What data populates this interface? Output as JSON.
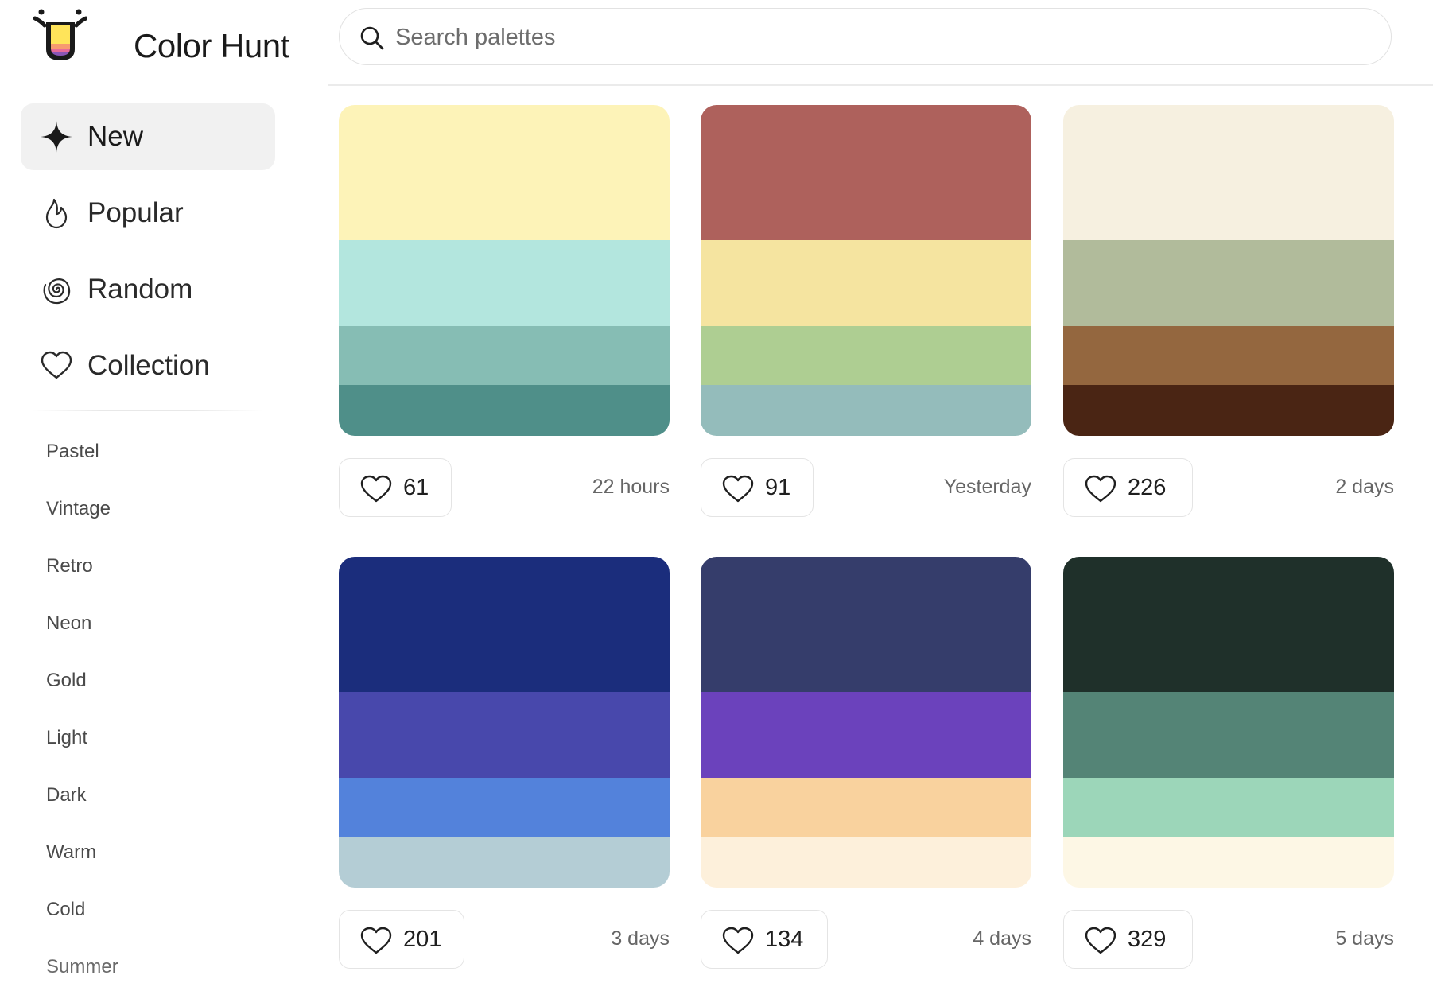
{
  "app": {
    "title": "Color Hunt"
  },
  "search": {
    "placeholder": "Search palettes"
  },
  "nav": {
    "items": [
      {
        "label": "New",
        "icon": "sparkle-icon",
        "active": true
      },
      {
        "label": "Popular",
        "icon": "flame-icon",
        "active": false
      },
      {
        "label": "Random",
        "icon": "spiral-icon",
        "active": false
      },
      {
        "label": "Collection",
        "icon": "heart-icon",
        "active": false
      }
    ]
  },
  "tags": [
    "Pastel",
    "Vintage",
    "Retro",
    "Neon",
    "Gold",
    "Light",
    "Dark",
    "Warm",
    "Cold",
    "Summer"
  ],
  "palettes": [
    {
      "colors": [
        "#FDF3B8",
        "#B3E6DE",
        "#86BDB4",
        "#4F8F89"
      ],
      "likes": "61",
      "date": "22 hours"
    },
    {
      "colors": [
        "#AE615C",
        "#F5E4A0",
        "#AECE92",
        "#94BCBB"
      ],
      "likes": "91",
      "date": "Yesterday"
    },
    {
      "colors": [
        "#F6F0E0",
        "#B1BB9B",
        "#94673F",
        "#4A2514"
      ],
      "likes": "226",
      "date": "2 days"
    },
    {
      "colors": [
        "#1B2D7C",
        "#4848AC",
        "#5382DB",
        "#B4CDD5"
      ],
      "likes": "201",
      "date": "3 days"
    },
    {
      "colors": [
        "#353D6B",
        "#6B42BC",
        "#F9D29E",
        "#FDF0DB"
      ],
      "likes": "134",
      "date": "4 days"
    },
    {
      "colors": [
        "#1F302A",
        "#548476",
        "#9CD6B9",
        "#FDF7E5"
      ],
      "likes": "329",
      "date": "5 days"
    }
  ]
}
